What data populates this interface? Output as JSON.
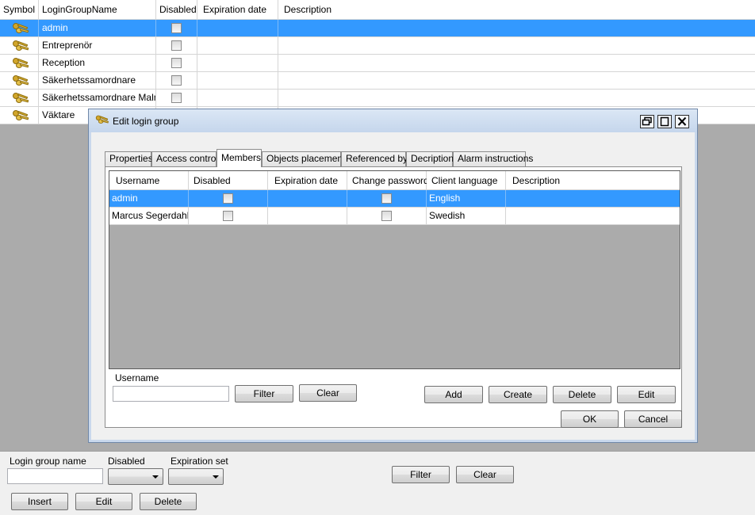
{
  "main_grid": {
    "columns": [
      "Symbol",
      "LoginGroupName",
      "Disabled",
      "Expiration date",
      "Description"
    ],
    "rows": [
      {
        "name": "admin"
      },
      {
        "name": "Entreprenör"
      },
      {
        "name": "Reception"
      },
      {
        "name": "Säkerhetssamordnare"
      },
      {
        "name": "Säkerhetssamordnare Malmö"
      },
      {
        "name": "Väktare"
      }
    ]
  },
  "bottom_panel": {
    "login_group_name_label": "Login group name",
    "login_group_name_value": "",
    "disabled_label": "Disabled",
    "expiration_set_label": "Expiration set",
    "filter_label": "Filter",
    "clear_label": "Clear",
    "insert_label": "Insert",
    "edit_label": "Edit",
    "delete_label": "Delete"
  },
  "dialog": {
    "title": "Edit login group",
    "tabs": [
      {
        "label": "Properties"
      },
      {
        "label": "Access control"
      },
      {
        "label": "Members"
      },
      {
        "label": "Objects placement"
      },
      {
        "label": "Referenced by"
      },
      {
        "label": "Decription"
      },
      {
        "label": "Alarm instructions"
      }
    ],
    "active_tab": "Members",
    "members": {
      "columns": [
        "Username",
        "Disabled",
        "Expiration date",
        "Change password",
        "Client language",
        "Description"
      ],
      "rows": [
        {
          "username": "admin",
          "language": "English"
        },
        {
          "username": "Marcus Segerdahl",
          "language": "Swedish"
        }
      ]
    },
    "username_label": "Username",
    "username_value": "",
    "filter_label": "Filter",
    "clear_label": "Clear",
    "add_label": "Add",
    "create_label": "Create",
    "delete_label": "Delete",
    "edit_label": "Edit",
    "ok_label": "OK",
    "cancel_label": "Cancel"
  },
  "colors": {
    "selection": "#3399ff",
    "dialog_frame": "#c9d8ec",
    "background": "#ababab"
  },
  "icons": {
    "row_symbol": "keys-icon",
    "dialog_title": "keys-icon",
    "restore": "restore-icon",
    "maximize": "maximize-icon",
    "close": "close-icon"
  }
}
